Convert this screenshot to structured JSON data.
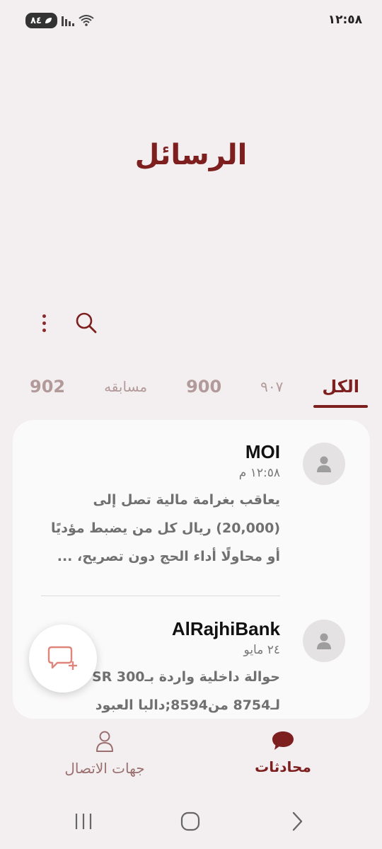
{
  "status_bar": {
    "time": "١٢:٥٨",
    "battery": "٨٤"
  },
  "header": {
    "title": "الرسائل"
  },
  "tabs": [
    {
      "label": "الكل",
      "active": true
    },
    {
      "label": "٩٠٧",
      "active": false
    },
    {
      "label": "900",
      "active": false
    },
    {
      "label": "مسابقه",
      "active": false
    },
    {
      "label": "902",
      "active": false
    }
  ],
  "conversations": [
    {
      "sender": "MOI",
      "time": "١٢:٥٨ م",
      "preview": [
        "يعاقب بغرامة مالية تصل إلى",
        "(20,000) ريال كل من يضبط مؤديًا",
        "أو محاولًا أداء الحج دون تصريح، ..."
      ]
    },
    {
      "sender": "AlRajhiBank",
      "time": "٢٤ مايو",
      "preview": [
        "حوالة داخلية واردة بـSR 300",
        "لـ8754 من8594;دالبا العبود"
      ]
    }
  ],
  "bottom_nav": {
    "chats": "محادثات",
    "contacts": "جهات الاتصال"
  },
  "colors": {
    "accent": "#7d1f1f",
    "background": "#f3eff0",
    "card": "#fbfafa"
  }
}
